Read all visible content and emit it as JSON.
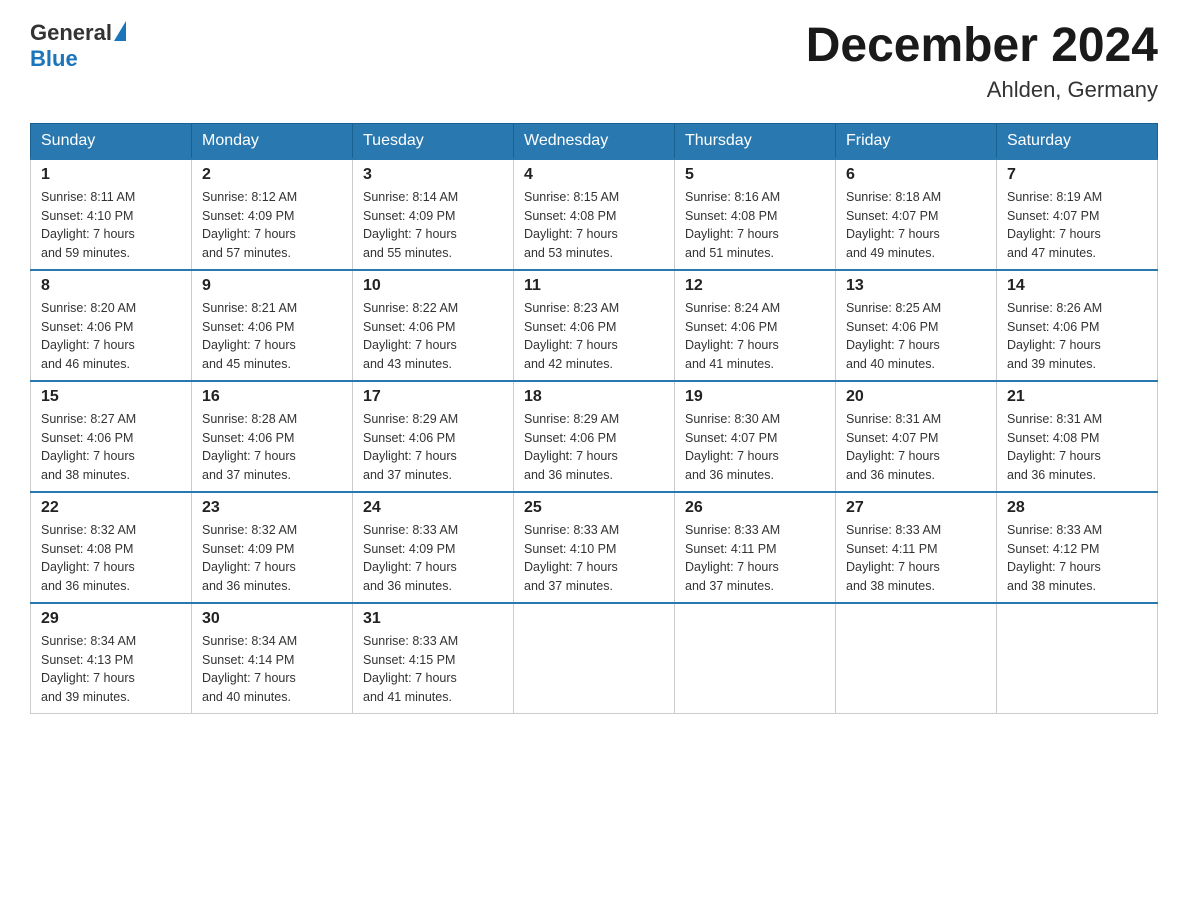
{
  "header": {
    "logo_general": "General",
    "logo_blue": "Blue",
    "title": "December 2024",
    "location": "Ahlden, Germany"
  },
  "days_of_week": [
    "Sunday",
    "Monday",
    "Tuesday",
    "Wednesday",
    "Thursday",
    "Friday",
    "Saturday"
  ],
  "weeks": [
    [
      {
        "day": "1",
        "sunrise": "8:11 AM",
        "sunset": "4:10 PM",
        "daylight": "7 hours and 59 minutes."
      },
      {
        "day": "2",
        "sunrise": "8:12 AM",
        "sunset": "4:09 PM",
        "daylight": "7 hours and 57 minutes."
      },
      {
        "day": "3",
        "sunrise": "8:14 AM",
        "sunset": "4:09 PM",
        "daylight": "7 hours and 55 minutes."
      },
      {
        "day": "4",
        "sunrise": "8:15 AM",
        "sunset": "4:08 PM",
        "daylight": "7 hours and 53 minutes."
      },
      {
        "day": "5",
        "sunrise": "8:16 AM",
        "sunset": "4:08 PM",
        "daylight": "7 hours and 51 minutes."
      },
      {
        "day": "6",
        "sunrise": "8:18 AM",
        "sunset": "4:07 PM",
        "daylight": "7 hours and 49 minutes."
      },
      {
        "day": "7",
        "sunrise": "8:19 AM",
        "sunset": "4:07 PM",
        "daylight": "7 hours and 47 minutes."
      }
    ],
    [
      {
        "day": "8",
        "sunrise": "8:20 AM",
        "sunset": "4:06 PM",
        "daylight": "7 hours and 46 minutes."
      },
      {
        "day": "9",
        "sunrise": "8:21 AM",
        "sunset": "4:06 PM",
        "daylight": "7 hours and 45 minutes."
      },
      {
        "day": "10",
        "sunrise": "8:22 AM",
        "sunset": "4:06 PM",
        "daylight": "7 hours and 43 minutes."
      },
      {
        "day": "11",
        "sunrise": "8:23 AM",
        "sunset": "4:06 PM",
        "daylight": "7 hours and 42 minutes."
      },
      {
        "day": "12",
        "sunrise": "8:24 AM",
        "sunset": "4:06 PM",
        "daylight": "7 hours and 41 minutes."
      },
      {
        "day": "13",
        "sunrise": "8:25 AM",
        "sunset": "4:06 PM",
        "daylight": "7 hours and 40 minutes."
      },
      {
        "day": "14",
        "sunrise": "8:26 AM",
        "sunset": "4:06 PM",
        "daylight": "7 hours and 39 minutes."
      }
    ],
    [
      {
        "day": "15",
        "sunrise": "8:27 AM",
        "sunset": "4:06 PM",
        "daylight": "7 hours and 38 minutes."
      },
      {
        "day": "16",
        "sunrise": "8:28 AM",
        "sunset": "4:06 PM",
        "daylight": "7 hours and 37 minutes."
      },
      {
        "day": "17",
        "sunrise": "8:29 AM",
        "sunset": "4:06 PM",
        "daylight": "7 hours and 37 minutes."
      },
      {
        "day": "18",
        "sunrise": "8:29 AM",
        "sunset": "4:06 PM",
        "daylight": "7 hours and 36 minutes."
      },
      {
        "day": "19",
        "sunrise": "8:30 AM",
        "sunset": "4:07 PM",
        "daylight": "7 hours and 36 minutes."
      },
      {
        "day": "20",
        "sunrise": "8:31 AM",
        "sunset": "4:07 PM",
        "daylight": "7 hours and 36 minutes."
      },
      {
        "day": "21",
        "sunrise": "8:31 AM",
        "sunset": "4:08 PM",
        "daylight": "7 hours and 36 minutes."
      }
    ],
    [
      {
        "day": "22",
        "sunrise": "8:32 AM",
        "sunset": "4:08 PM",
        "daylight": "7 hours and 36 minutes."
      },
      {
        "day": "23",
        "sunrise": "8:32 AM",
        "sunset": "4:09 PM",
        "daylight": "7 hours and 36 minutes."
      },
      {
        "day": "24",
        "sunrise": "8:33 AM",
        "sunset": "4:09 PM",
        "daylight": "7 hours and 36 minutes."
      },
      {
        "day": "25",
        "sunrise": "8:33 AM",
        "sunset": "4:10 PM",
        "daylight": "7 hours and 37 minutes."
      },
      {
        "day": "26",
        "sunrise": "8:33 AM",
        "sunset": "4:11 PM",
        "daylight": "7 hours and 37 minutes."
      },
      {
        "day": "27",
        "sunrise": "8:33 AM",
        "sunset": "4:11 PM",
        "daylight": "7 hours and 38 minutes."
      },
      {
        "day": "28",
        "sunrise": "8:33 AM",
        "sunset": "4:12 PM",
        "daylight": "7 hours and 38 minutes."
      }
    ],
    [
      {
        "day": "29",
        "sunrise": "8:34 AM",
        "sunset": "4:13 PM",
        "daylight": "7 hours and 39 minutes."
      },
      {
        "day": "30",
        "sunrise": "8:34 AM",
        "sunset": "4:14 PM",
        "daylight": "7 hours and 40 minutes."
      },
      {
        "day": "31",
        "sunrise": "8:33 AM",
        "sunset": "4:15 PM",
        "daylight": "7 hours and 41 minutes."
      },
      null,
      null,
      null,
      null
    ]
  ],
  "labels": {
    "sunrise": "Sunrise:",
    "sunset": "Sunset:",
    "daylight": "Daylight:"
  }
}
